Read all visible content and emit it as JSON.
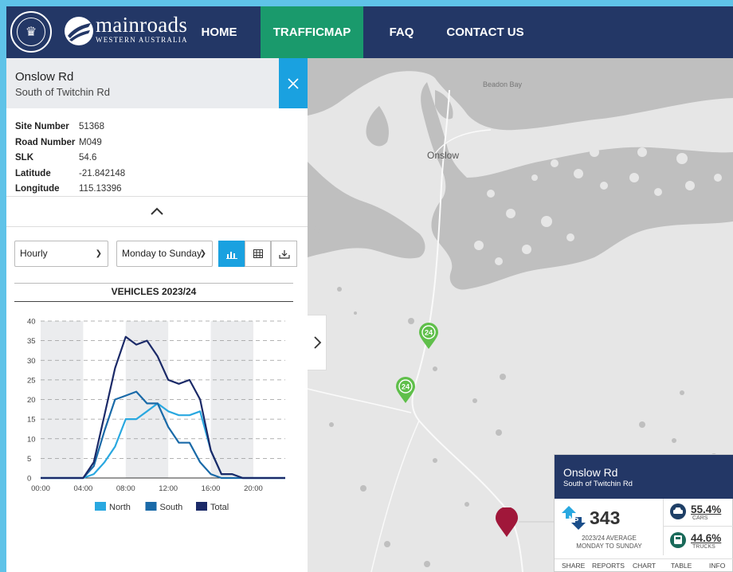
{
  "header": {
    "logo_main": "mainroads",
    "logo_sub": "WESTERN AUSTRALIA",
    "nav": [
      {
        "label": "HOME"
      },
      {
        "label": "TRAFFICMAP"
      },
      {
        "label": "FAQ"
      },
      {
        "label": "CONTACT US"
      }
    ],
    "active_nav": "TRAFFICMAP"
  },
  "panel": {
    "road_name": "Onslow Rd",
    "road_sub": "South of Twitchin Rd",
    "close_icon": "close-icon",
    "info": [
      {
        "key": "Site Number",
        "value": "51368"
      },
      {
        "key": "Road Number",
        "value": "M049"
      },
      {
        "key": "SLK",
        "value": "54.6"
      },
      {
        "key": "Latitude",
        "value": "-21.842148"
      },
      {
        "key": "Longitude",
        "value": "115.13396"
      }
    ],
    "period_select": "Hourly",
    "days_select": "Monday to Sunday",
    "view_buttons": [
      "chart-icon",
      "table-icon",
      "download-icon"
    ]
  },
  "chart_data": {
    "type": "line",
    "title": "VEHICLES 2023/24",
    "xlabel": "",
    "ylabel": "",
    "x": [
      0,
      1,
      2,
      3,
      4,
      5,
      6,
      7,
      8,
      9,
      10,
      11,
      12,
      13,
      14,
      15,
      16,
      17,
      18,
      19,
      20,
      21,
      22,
      23
    ],
    "x_tick_labels": [
      "00:00",
      "04:00",
      "08:00",
      "12:00",
      "16:00",
      "20:00"
    ],
    "x_tick_positions": [
      0,
      4,
      8,
      12,
      16,
      20
    ],
    "ylim": [
      0,
      40
    ],
    "yticks": [
      0,
      5,
      10,
      15,
      20,
      25,
      30,
      35,
      40
    ],
    "grid": "dashed-horizontal",
    "shaded_bands": [
      [
        0,
        4
      ],
      [
        8,
        12
      ],
      [
        16,
        20
      ]
    ],
    "legend_position": "bottom",
    "series": [
      {
        "name": "North",
        "color": "#29a8e0",
        "values": [
          0,
          0,
          0,
          0,
          0,
          1,
          4,
          8,
          15,
          15,
          17,
          19,
          17,
          16,
          16,
          17,
          7,
          1,
          1,
          0,
          0,
          0,
          0,
          0
        ]
      },
      {
        "name": "South",
        "color": "#1a6aa8",
        "values": [
          0,
          0,
          0,
          0,
          0,
          3,
          12,
          20,
          21,
          22,
          19,
          19,
          13,
          9,
          9,
          4,
          1,
          0,
          0,
          0,
          0,
          0,
          0,
          0
        ]
      },
      {
        "name": "Total",
        "color": "#1b2a68",
        "values": [
          0,
          0,
          0,
          0,
          0,
          4,
          16,
          28,
          36,
          34,
          35,
          31,
          25,
          24,
          25,
          20,
          7,
          1,
          1,
          0,
          0,
          0,
          0,
          0
        ]
      }
    ]
  },
  "map": {
    "town_label": "Onslow",
    "bay_label": "Beadon Bay",
    "land_color": "#e6e6e6",
    "water_color": "#bfbfbf",
    "marker_green_color": "#5fbf4a",
    "marker_red_color": "#a0173a",
    "marker_text": "24"
  },
  "card": {
    "title": "Onslow Rd",
    "sub": "South of Twitchin Rd",
    "direction_badge": "NS",
    "volume": "343",
    "avg_line1": "2023/24 AVERAGE",
    "avg_line2": "MONDAY TO SUNDAY",
    "cars_pct": "55.4%",
    "cars_label": "CARS",
    "trucks_pct": "44.6%",
    "trucks_label": "TRUCKS",
    "tabs": [
      "SHARE",
      "REPORTS",
      "CHART",
      "TABLE",
      "INFO"
    ]
  }
}
